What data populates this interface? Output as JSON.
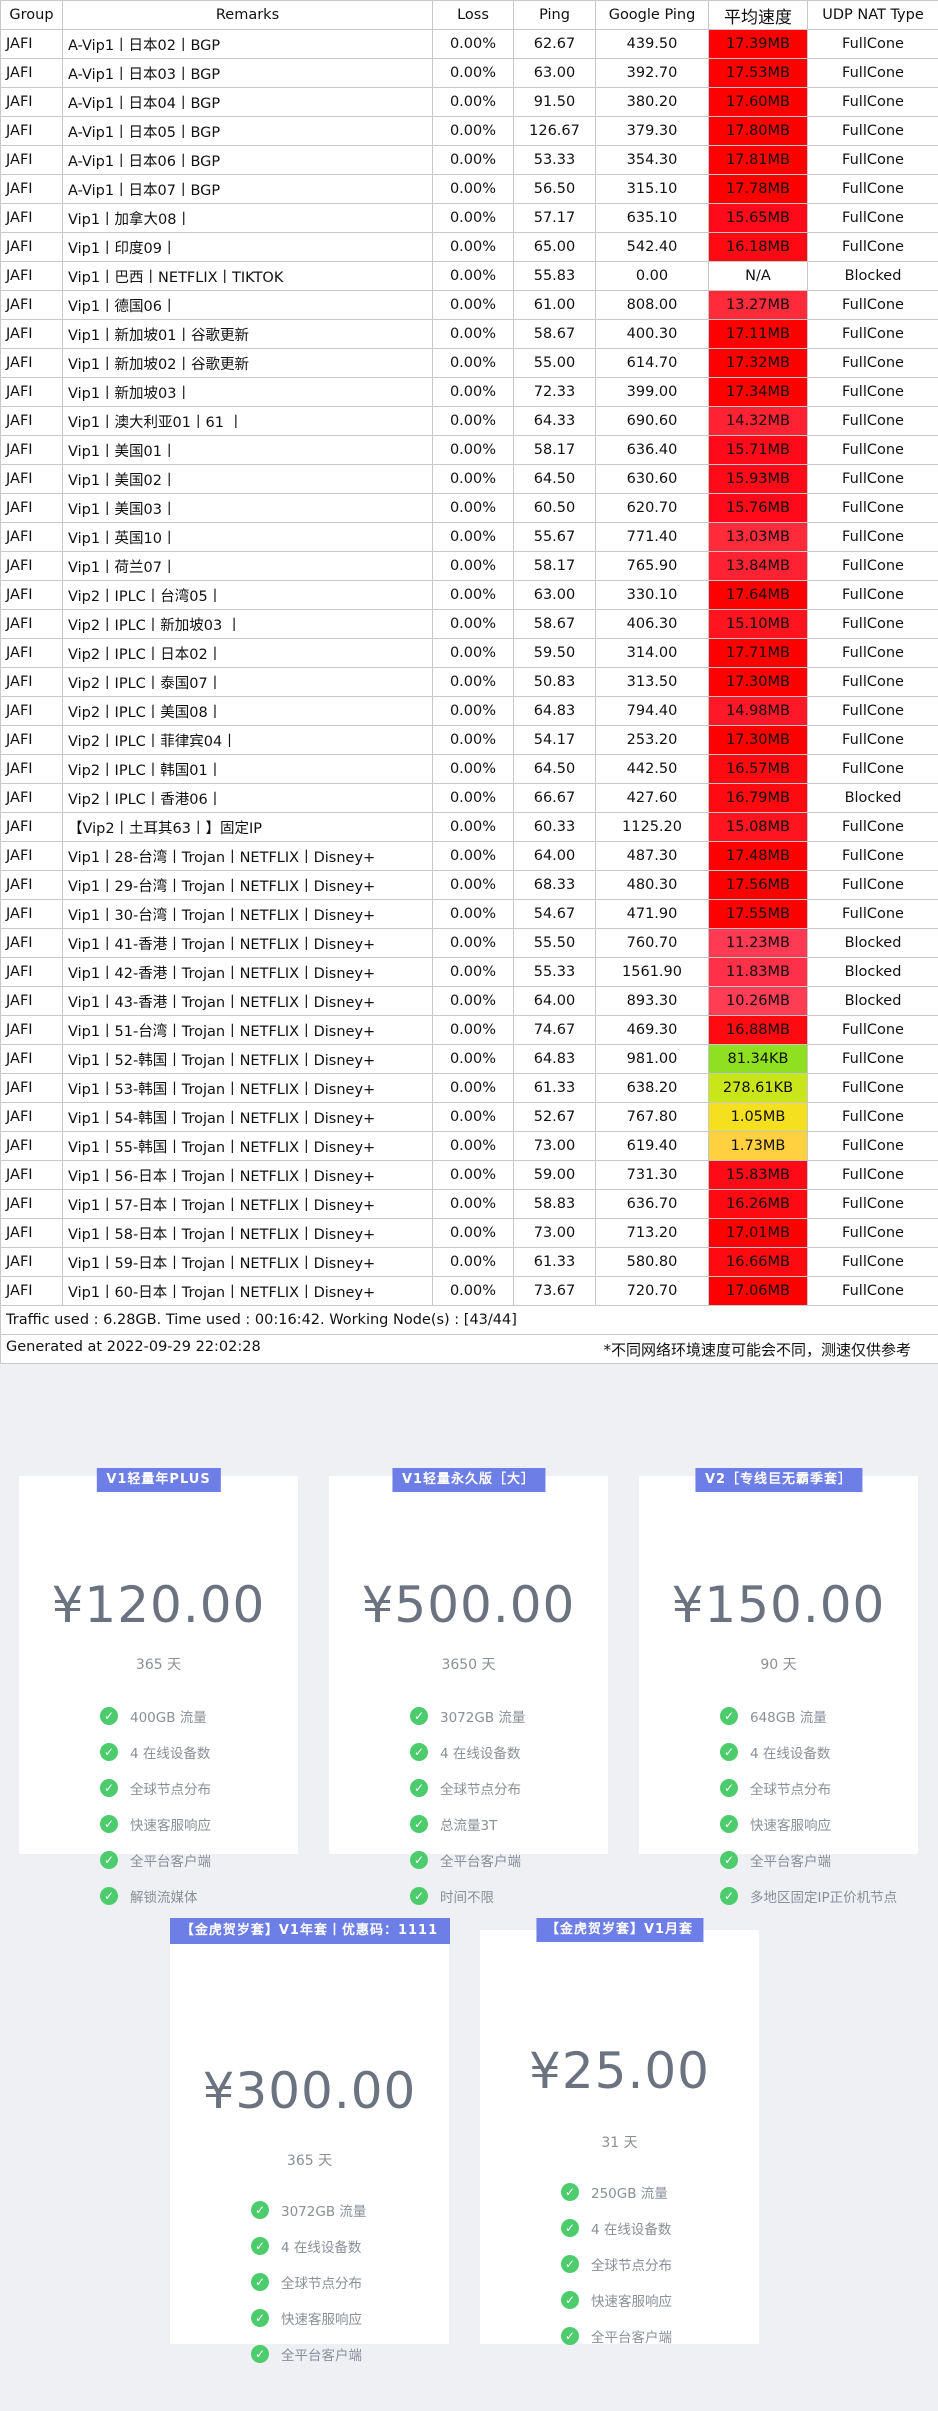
{
  "table": {
    "headers": [
      "Group",
      "Remarks",
      "Loss",
      "Ping",
      "Google Ping",
      "平均速度",
      "UDP NAT Type"
    ],
    "rows": [
      [
        "JAFI",
        "A-Vip1丨日本02丨BGP",
        "0.00%",
        "62.67",
        "439.50",
        "17.39MB",
        "FullCone"
      ],
      [
        "JAFI",
        "A-Vip1丨日本03丨BGP",
        "0.00%",
        "63.00",
        "392.70",
        "17.53MB",
        "FullCone"
      ],
      [
        "JAFI",
        "A-Vip1丨日本04丨BGP",
        "0.00%",
        "91.50",
        "380.20",
        "17.60MB",
        "FullCone"
      ],
      [
        "JAFI",
        "A-Vip1丨日本05丨BGP",
        "0.00%",
        "126.67",
        "379.30",
        "17.80MB",
        "FullCone"
      ],
      [
        "JAFI",
        "A-Vip1丨日本06丨BGP",
        "0.00%",
        "53.33",
        "354.30",
        "17.81MB",
        "FullCone"
      ],
      [
        "JAFI",
        "A-Vip1丨日本07丨BGP",
        "0.00%",
        "56.50",
        "315.10",
        "17.78MB",
        "FullCone"
      ],
      [
        "JAFI",
        "Vip1丨加拿大08丨",
        "0.00%",
        "57.17",
        "635.10",
        "15.65MB",
        "FullCone"
      ],
      [
        "JAFI",
        "Vip1丨印度09丨",
        "0.00%",
        "65.00",
        "542.40",
        "16.18MB",
        "FullCone"
      ],
      [
        "JAFI",
        "Vip1丨巴西丨NETFLIX丨TIKTOK",
        "0.00%",
        "55.83",
        "0.00",
        "N/A",
        "Blocked"
      ],
      [
        "JAFI",
        "Vip1丨德国06丨",
        "0.00%",
        "61.00",
        "808.00",
        "13.27MB",
        "FullCone"
      ],
      [
        "JAFI",
        "Vip1丨新加坡01丨谷歌更新",
        "0.00%",
        "58.67",
        "400.30",
        "17.11MB",
        "FullCone"
      ],
      [
        "JAFI",
        "Vip1丨新加坡02丨谷歌更新",
        "0.00%",
        "55.00",
        "614.70",
        "17.32MB",
        "FullCone"
      ],
      [
        "JAFI",
        "Vip1丨新加坡03丨",
        "0.00%",
        "72.33",
        "399.00",
        "17.34MB",
        "FullCone"
      ],
      [
        "JAFI",
        "Vip1丨澳大利亚01丨61 丨",
        "0.00%",
        "64.33",
        "690.60",
        "14.32MB",
        "FullCone"
      ],
      [
        "JAFI",
        "Vip1丨美国01丨",
        "0.00%",
        "58.17",
        "636.40",
        "15.71MB",
        "FullCone"
      ],
      [
        "JAFI",
        "Vip1丨美国02丨",
        "0.00%",
        "64.50",
        "630.60",
        "15.93MB",
        "FullCone"
      ],
      [
        "JAFI",
        "Vip1丨美国03丨",
        "0.00%",
        "60.50",
        "620.70",
        "15.76MB",
        "FullCone"
      ],
      [
        "JAFI",
        "Vip1丨英国10丨",
        "0.00%",
        "55.67",
        "771.40",
        "13.03MB",
        "FullCone"
      ],
      [
        "JAFI",
        "Vip1丨荷兰07丨",
        "0.00%",
        "58.17",
        "765.90",
        "13.84MB",
        "FullCone"
      ],
      [
        "JAFI",
        "Vip2丨IPLC丨台湾05丨",
        "0.00%",
        "63.00",
        "330.10",
        "17.64MB",
        "FullCone"
      ],
      [
        "JAFI",
        "Vip2丨IPLC丨新加坡03 丨",
        "0.00%",
        "58.67",
        "406.30",
        "15.10MB",
        "FullCone"
      ],
      [
        "JAFI",
        "Vip2丨IPLC丨日本02丨",
        "0.00%",
        "59.50",
        "314.00",
        "17.71MB",
        "FullCone"
      ],
      [
        "JAFI",
        "Vip2丨IPLC丨泰国07丨",
        "0.00%",
        "50.83",
        "313.50",
        "17.30MB",
        "FullCone"
      ],
      [
        "JAFI",
        "Vip2丨IPLC丨美国08丨",
        "0.00%",
        "64.83",
        "794.40",
        "14.98MB",
        "FullCone"
      ],
      [
        "JAFI",
        "Vip2丨IPLC丨菲律宾04丨",
        "0.00%",
        "54.17",
        "253.20",
        "17.30MB",
        "FullCone"
      ],
      [
        "JAFI",
        "Vip2丨IPLC丨韩国01丨",
        "0.00%",
        "64.50",
        "442.50",
        "16.57MB",
        "FullCone"
      ],
      [
        "JAFI",
        "Vip2丨IPLC丨香港06丨",
        "0.00%",
        "66.67",
        "427.60",
        "16.79MB",
        "Blocked"
      ],
      [
        "JAFI",
        "【Vip2丨土耳其63丨】固定IP",
        "0.00%",
        "60.33",
        "1125.20",
        "15.08MB",
        "FullCone"
      ],
      [
        "JAFI",
        "Vip1丨28-台湾丨Trojan丨NETFLIX丨Disney+",
        "0.00%",
        "64.00",
        "487.30",
        "17.48MB",
        "FullCone"
      ],
      [
        "JAFI",
        "Vip1丨29-台湾丨Trojan丨NETFLIX丨Disney+",
        "0.00%",
        "68.33",
        "480.30",
        "17.56MB",
        "FullCone"
      ],
      [
        "JAFI",
        "Vip1丨30-台湾丨Trojan丨NETFLIX丨Disney+",
        "0.00%",
        "54.67",
        "471.90",
        "17.55MB",
        "FullCone"
      ],
      [
        "JAFI",
        "Vip1丨41-香港丨Trojan丨NETFLIX丨Disney+",
        "0.00%",
        "55.50",
        "760.70",
        "11.23MB",
        "Blocked"
      ],
      [
        "JAFI",
        "Vip1丨42-香港丨Trojan丨NETFLIX丨Disney+",
        "0.00%",
        "55.33",
        "1561.90",
        "11.83MB",
        "Blocked"
      ],
      [
        "JAFI",
        "Vip1丨43-香港丨Trojan丨NETFLIX丨Disney+",
        "0.00%",
        "64.00",
        "893.30",
        "10.26MB",
        "Blocked"
      ],
      [
        "JAFI",
        "Vip1丨51-台湾丨Trojan丨NETFLIX丨Disney+",
        "0.00%",
        "74.67",
        "469.30",
        "16.88MB",
        "FullCone"
      ],
      [
        "JAFI",
        "Vip1丨52-韩国丨Trojan丨NETFLIX丨Disney+",
        "0.00%",
        "64.83",
        "981.00",
        "81.34KB",
        "FullCone"
      ],
      [
        "JAFI",
        "Vip1丨53-韩国丨Trojan丨NETFLIX丨Disney+",
        "0.00%",
        "61.33",
        "638.20",
        "278.61KB",
        "FullCone"
      ],
      [
        "JAFI",
        "Vip1丨54-韩国丨Trojan丨NETFLIX丨Disney+",
        "0.00%",
        "52.67",
        "767.80",
        "1.05MB",
        "FullCone"
      ],
      [
        "JAFI",
        "Vip1丨55-韩国丨Trojan丨NETFLIX丨Disney+",
        "0.00%",
        "73.00",
        "619.40",
        "1.73MB",
        "FullCone"
      ],
      [
        "JAFI",
        "Vip1丨56-日本丨Trojan丨NETFLIX丨Disney+",
        "0.00%",
        "59.00",
        "731.30",
        "15.83MB",
        "FullCone"
      ],
      [
        "JAFI",
        "Vip1丨57-日本丨Trojan丨NETFLIX丨Disney+",
        "0.00%",
        "58.83",
        "636.70",
        "16.26MB",
        "FullCone"
      ],
      [
        "JAFI",
        "Vip1丨58-日本丨Trojan丨NETFLIX丨Disney+",
        "0.00%",
        "73.00",
        "713.20",
        "17.01MB",
        "FullCone"
      ],
      [
        "JAFI",
        "Vip1丨59-日本丨Trojan丨NETFLIX丨Disney+",
        "0.00%",
        "61.33",
        "580.80",
        "16.66MB",
        "FullCone"
      ],
      [
        "JAFI",
        "Vip1丨60-日本丨Trojan丨NETFLIX丨Disney+",
        "0.00%",
        "73.67",
        "720.70",
        "17.06MB",
        "FullCone"
      ]
    ],
    "speed_colors": [
      "#ff0000",
      "#ff0000",
      "#ff0000",
      "#ff0000",
      "#ff0000",
      "#ff0000",
      "#ff0a1a",
      "#ff0a12",
      "#ffffff",
      "#ff2a3a",
      "#ff0000",
      "#ff0000",
      "#ff0000",
      "#ff2232",
      "#ff0a1a",
      "#ff0a18",
      "#ff0a1a",
      "#ff2a3a",
      "#ff2232",
      "#ff0000",
      "#ff1420",
      "#ff0000",
      "#ff0000",
      "#ff1828",
      "#ff0000",
      "#ff0a10",
      "#ff0a10",
      "#ff1420",
      "#ff0000",
      "#ff0000",
      "#ff0000",
      "#ff3a52",
      "#ff3048",
      "#ff3e56",
      "#ff0a10",
      "#8ee020",
      "#c8e61a",
      "#f5e020",
      "#ffd040",
      "#ff0a16",
      "#ff0a12",
      "#ff0000",
      "#ff0a10",
      "#ff0000"
    ],
    "footer_traffic": "Traffic used : 6.28GB. Time used : 00:16:42. Working Node(s) : [43/44]",
    "footer_generated": "Generated at 2022-09-29 22:02:28",
    "footer_note": "*不同网络环境速度可能会不同，测速仅供参考"
  },
  "plans": [
    {
      "badge": "V1轻量年PLUS",
      "price": "¥120.00",
      "days": "365 天",
      "features": [
        "400GB 流量",
        "4 在线设备数",
        "全球节点分布",
        "快速客服响应",
        "全平台客户端",
        "解锁流媒体"
      ]
    },
    {
      "badge": "V1轻量永久版［大］",
      "price": "¥500.00",
      "days": "3650 天",
      "features": [
        "3072GB 流量",
        "4 在线设备数",
        "全球节点分布",
        "总流量3T",
        "全平台客户端",
        "时间不限"
      ]
    },
    {
      "badge": "V2［专线巨无霸季套］",
      "price": "¥150.00",
      "days": "90 天",
      "features": [
        "648GB 流量",
        "4 在线设备数",
        "全球节点分布",
        "快速客服响应",
        "全平台客户端",
        "多地区固定IP正价机节点"
      ]
    },
    {
      "badge": "【金虎贺岁套】V1年套丨优惠码：1111",
      "price": "¥300.00",
      "days": "365 天",
      "features": [
        "3072GB 流量",
        "4 在线设备数",
        "全球节点分布",
        "快速客服响应",
        "全平台客户端"
      ]
    },
    {
      "badge": "【金虎贺岁套】V1月套",
      "price": "¥25.00",
      "days": "31 天",
      "features": [
        "250GB 流量",
        "4 在线设备数",
        "全球节点分布",
        "快速客服响应",
        "全平台客户端"
      ]
    }
  ],
  "colors": {
    "badge": "#6d7ee6",
    "check": "#4ccc6d",
    "price_text": "#6b7280"
  },
  "icons": {
    "feature": "check-circle-icon"
  }
}
